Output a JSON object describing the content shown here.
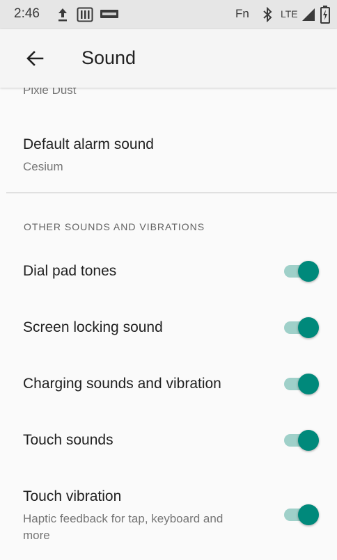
{
  "status_bar": {
    "time": "2:46",
    "fn_label": "Fn",
    "network_label": "LTE",
    "icons": [
      "upload-icon",
      "sim-card-icon",
      "volte-icon",
      "bluetooth-icon",
      "signal-icon",
      "battery-charging-icon"
    ]
  },
  "app_bar": {
    "title": "Sound",
    "back_icon": "arrow-back-icon"
  },
  "prefs": {
    "clipped_summary": "Pixie Dust",
    "default_alarm": {
      "title": "Default alarm sound",
      "summary": "Cesium"
    }
  },
  "section": {
    "header": "OTHER SOUNDS AND VIBRATIONS",
    "items": [
      {
        "title": "Dial pad tones",
        "enabled": true
      },
      {
        "title": "Screen locking sound",
        "enabled": true
      },
      {
        "title": "Charging sounds and vibration",
        "enabled": true
      },
      {
        "title": "Touch sounds",
        "enabled": true
      },
      {
        "title": "Touch vibration",
        "summary": "Haptic feedback for tap, keyboard and more",
        "enabled": true
      }
    ]
  },
  "colors": {
    "accent": "#00897b",
    "track_on": "#9fd0c9",
    "background": "#fafafa"
  }
}
